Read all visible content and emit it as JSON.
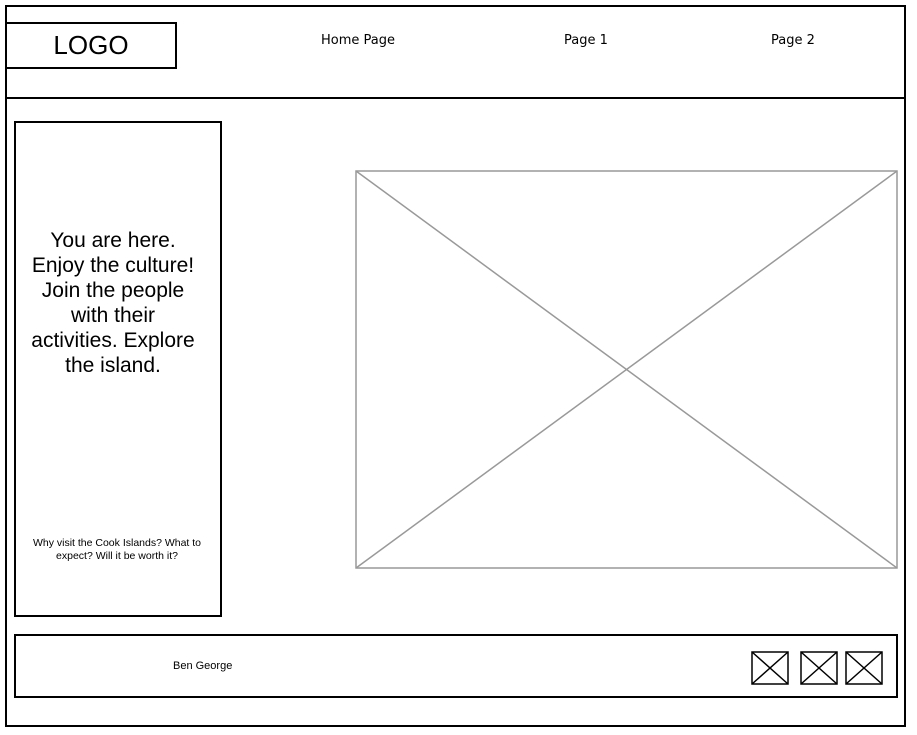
{
  "header": {
    "logo_text": "LOGO",
    "nav": [
      {
        "label": "Home Page"
      },
      {
        "label": "Page 1"
      },
      {
        "label": "Page 2"
      }
    ]
  },
  "sidebar": {
    "main_text": "You are here. Enjoy the culture! Join the people with their activities. Explore the island.",
    "sub_text": "Why visit the Cook Islands? What to expect? Will it be worth it?"
  },
  "footer": {
    "author": "Ben George",
    "social_icons": [
      "image-placeholder-icon",
      "image-placeholder-icon",
      "image-placeholder-icon"
    ]
  },
  "colors": {
    "stroke": "#000000",
    "placeholder_stroke": "#999999",
    "background": "#ffffff"
  }
}
